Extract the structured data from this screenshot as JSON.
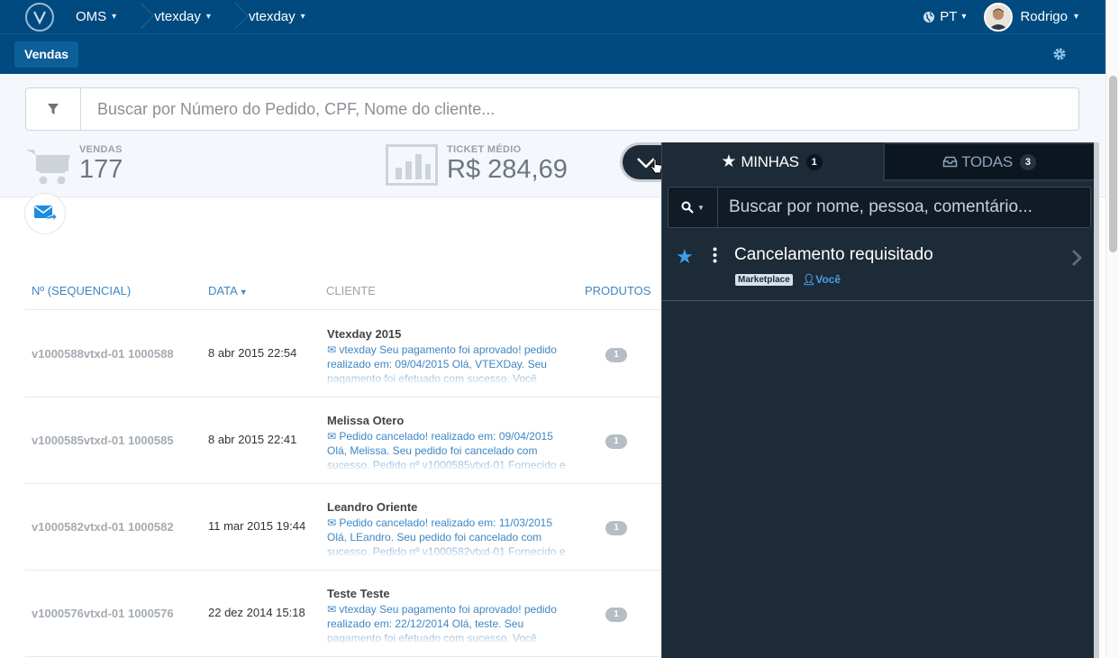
{
  "topbar": {
    "crumbs": [
      "OMS",
      "vtexday",
      "vtexday"
    ],
    "language": "PT",
    "user": "Rodrigo"
  },
  "subbar": {
    "active_tab": "Vendas"
  },
  "search": {
    "placeholder": "Buscar por Número do Pedido, CPF, Nome do cliente..."
  },
  "stats": {
    "sales_label": "VENDAS",
    "sales_value": "177",
    "ticket_label": "TICKET MÉDIO",
    "ticket_value": "R$ 284,69"
  },
  "table": {
    "headers": [
      "Nº (SEQUENCIAL)",
      "DATA",
      "CLIENTE",
      "PRODUTOS"
    ],
    "rows": [
      {
        "seq": "v1000588vtxd-01 1000588",
        "date": "8 abr 2015 22:54",
        "client": "Vtexday 2015",
        "message": "vtexday Seu pagamento foi aprovado! pedido realizado em: 09/04/2015 Olá, VTEXDay. Seu pagamento foi efetuado com sucesso. Você receberá",
        "products": "1"
      },
      {
        "seq": "v1000585vtxd-01 1000585",
        "date": "8 abr 2015 22:41",
        "client": "Melissa Otero",
        "message": "Pedido cancelado! realizado em: 09/04/2015 Olá, Melissa. Seu pedido foi cancelado com sucesso. Pedido nº v1000585vtxd-01 Fornecido e entr",
        "products": "1"
      },
      {
        "seq": "v1000582vtxd-01 1000582",
        "date": "11 mar 2015 19:44",
        "client": "Leandro Oriente",
        "message": "Pedido cancelado! realizado em: 11/03/2015 Olá, LEandro. Seu pedido foi cancelado com sucesso. Pedido nº v1000582vtxd-01 Fornecido e entr",
        "products": "1"
      },
      {
        "seq": "v1000576vtxd-01 1000576",
        "date": "22 dez 2014 15:18",
        "client": "Teste Teste",
        "message": "vtexday Seu pagamento foi aprovado! pedido realizado em: 22/12/2014 Olá, teste. Seu pagamento foi efetuado com sucesso. Você receberá outr",
        "products": "1"
      }
    ]
  },
  "panel": {
    "tab_mine": "MINHAS",
    "tab_mine_count": "1",
    "tab_all": "TODAS",
    "tab_all_count": "3",
    "search_placeholder": "Buscar por nome, pessoa, comentário...",
    "item": {
      "title": "Cancelamento requisitado",
      "tag": "Marketplace",
      "owner": "Você"
    }
  },
  "colors": {
    "nav": "#004a80",
    "panel": "#1d2a37",
    "accent": "#3e86c3"
  }
}
